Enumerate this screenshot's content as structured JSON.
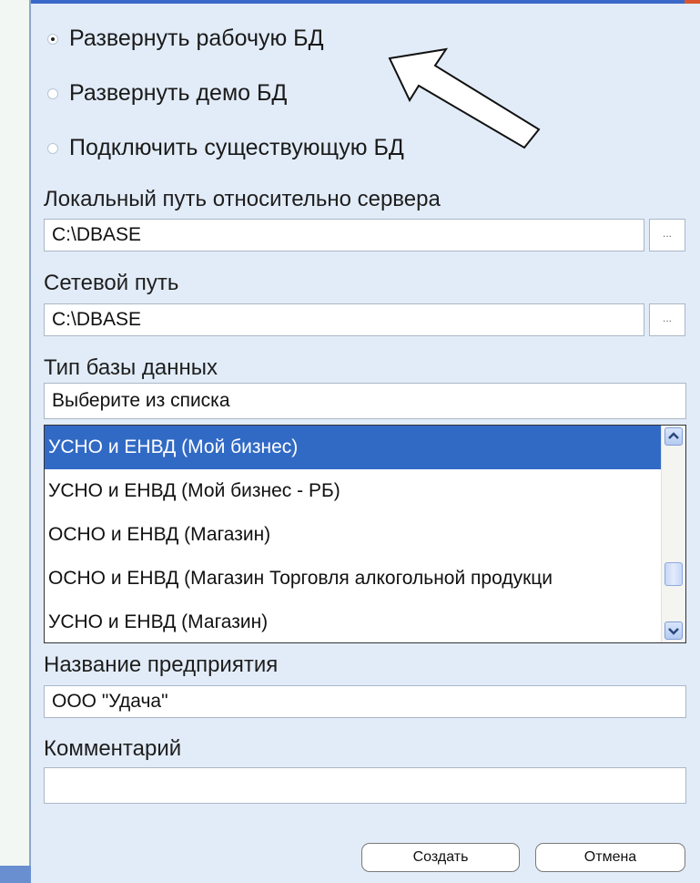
{
  "options": [
    {
      "label": "Развернуть рабочую БД",
      "checked": true
    },
    {
      "label": "Развернуть демо БД",
      "checked": false
    },
    {
      "label": "Подключить существующую БД",
      "checked": false
    }
  ],
  "local_path": {
    "label": "Локальный путь относительно сервера",
    "value": "C:\\DBASE",
    "browse": "..."
  },
  "network_path": {
    "label": "Сетевой путь",
    "value": "C:\\DBASE",
    "browse": "..."
  },
  "db_type": {
    "label": "Тип базы данных",
    "selected_text": "Выберите из списка",
    "items": [
      "УСНО и ЕНВД (Мой бизнес)",
      "УСНО и ЕНВД (Мой бизнес - РБ)",
      "ОСНО и ЕНВД (Магазин)",
      "ОСНО и ЕНВД (Магазин Торговля алкогольной продукци",
      "УСНО и ЕНВД (Магазин)"
    ],
    "selected_index": 0
  },
  "company": {
    "label": "Название предприятия",
    "value": "ООО \"Удача\""
  },
  "comment": {
    "label": "Комментарий",
    "value": ""
  },
  "buttons": {
    "create": "Создать",
    "cancel": "Отмена"
  },
  "colors": {
    "selection": "#316ac5",
    "panel": "#e2ecf8"
  }
}
